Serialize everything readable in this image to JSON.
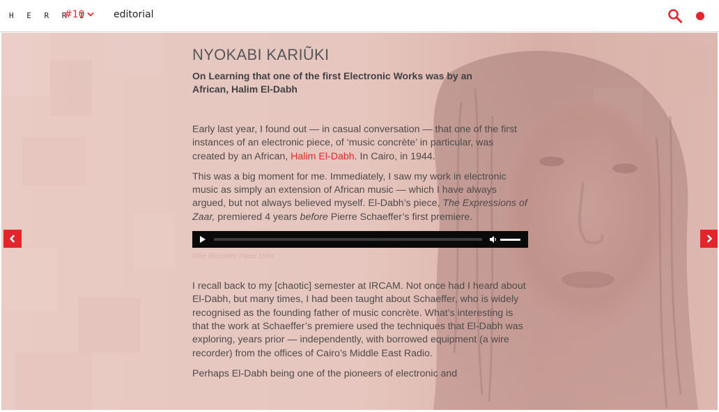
{
  "header": {
    "logo_text": "H E R R I",
    "issue_label": "#10",
    "section_label": "editorial"
  },
  "icons": {
    "issue_dropdown": "chevron-down-icon",
    "search": "search-icon",
    "record": "record-dot-icon",
    "prev": "chevron-left-icon",
    "next": "chevron-right-icon"
  },
  "colors": {
    "accent": "#e3262b",
    "background_tint": "#e7c7bf"
  },
  "article": {
    "author": "NYOKABI KARIŨKI",
    "subtitle": "On Learning that one of the first Electronic Works was by an African, Halim El-Dabh",
    "p1_a": "Early last year, I found out — in casual conversation — that one of the first instances of an electronic piece, of ‘music concrète’ in particular, was created by an African, ",
    "p1_link": "Halim El-Dabh",
    "p1_b": ". In Cairo, in 1944.",
    "p2_a": "This was a big moment for me. Immediately, I saw my work in electronic music as simply an extension of African music — which I have always argued, but not always believed myself. El-Dabh’s piece, ",
    "p2_em1": "The Expressions of Zaar,",
    "p2_b": " premiered 4 years ",
    "p2_em2": "before",
    "p2_c": " Pierre Schaeffer’s first premiere.",
    "audio_caption": "Wire Recorder Piece 1944",
    "p3": "I recall back to my [chaotic] semester at IRCAM. Not once had I heard about El-Dabh, but many times, I had been taught about Schaeffer, who is widely recognised as the founding father of music concrète. What’s interesting is that the work at Schaeffer’s premiere used the techniques that El-Dabh was exploring, years prior — independently, with borrowed equipment (a wire recorder) from the offices of Cairo’s Middle East Radio.",
    "p4": "Perhaps El-Dabh being one of the pioneers of electronic and"
  }
}
